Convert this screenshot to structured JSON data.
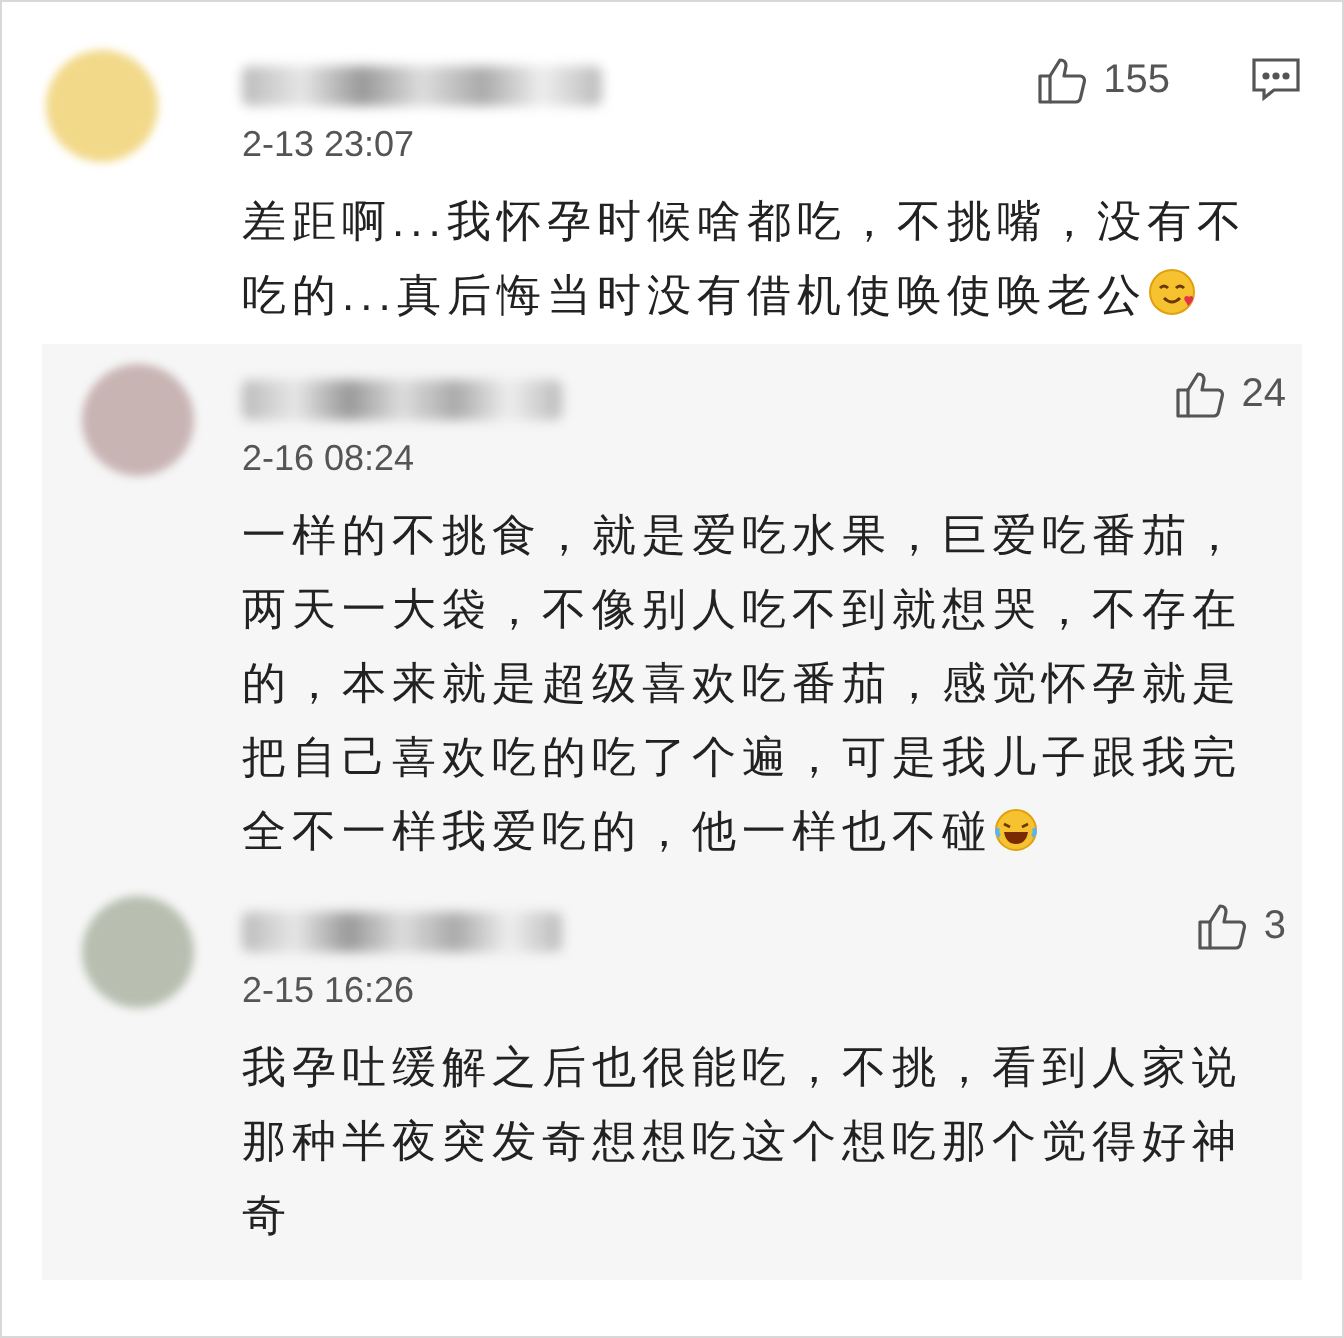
{
  "comment": {
    "date": "2-13 23:07",
    "likes": "155",
    "text": "差距啊...我怀孕时候啥都吃，不挑嘴，没有不吃的...真后悔当时没有借机使唤使唤老公"
  },
  "replies": [
    {
      "date": "2-16 08:24",
      "likes": "24",
      "text": "一样的不挑食，就是爱吃水果，巨爱吃番茄，两天一大袋，不像别人吃不到就想哭，不存在的，本来就是超级喜欢吃番茄，感觉怀孕就是把自己喜欢吃的吃了个遍，可是我儿子跟我完全不一样我爱吃的，他一样也不碰"
    },
    {
      "date": "2-15 16:26",
      "likes": "3",
      "text": "我孕吐缓解之后也很能吃，不挑，看到人家说那种半夜突发奇想想吃这个想吃那个觉得好神奇"
    }
  ]
}
